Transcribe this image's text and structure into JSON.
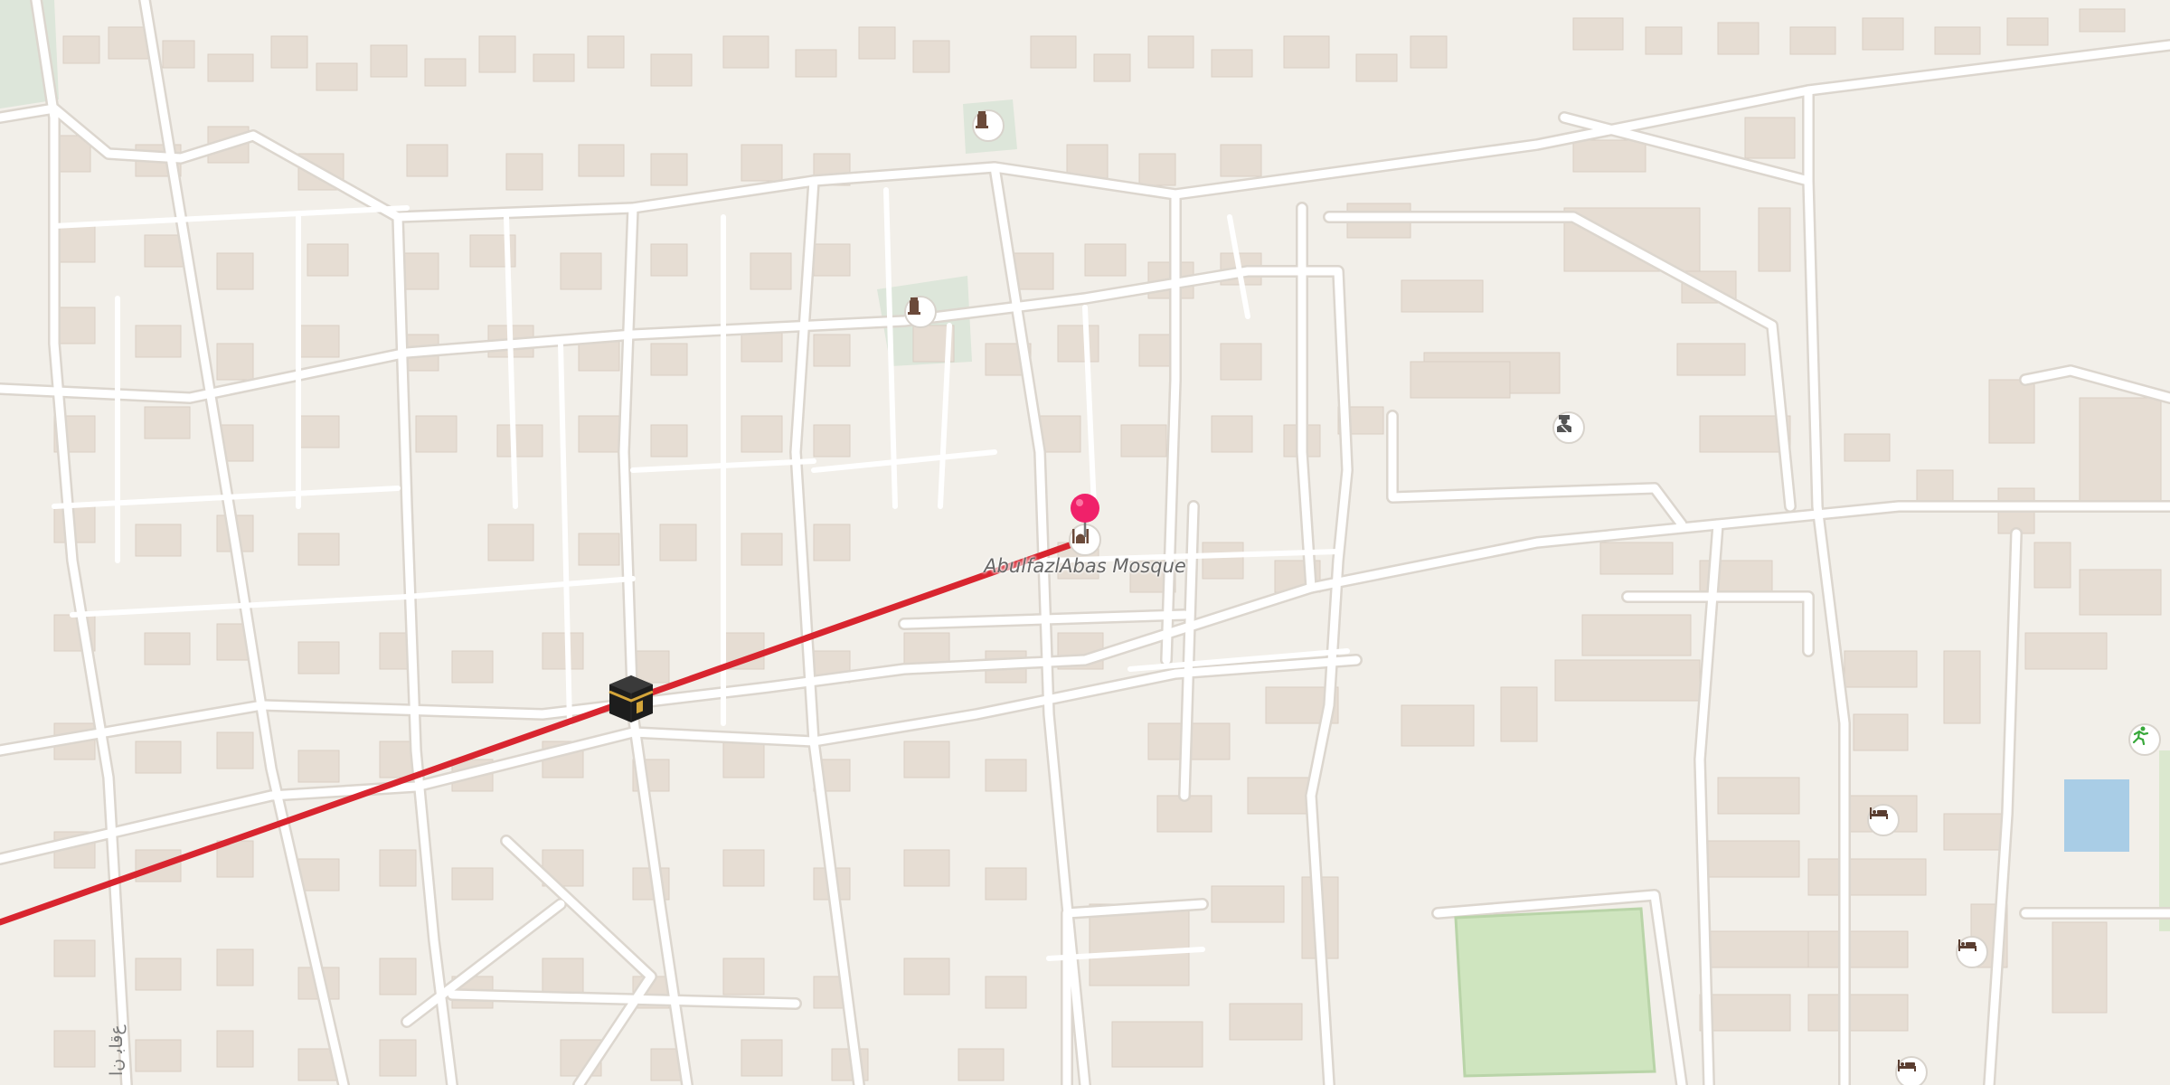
{
  "map": {
    "place_label": "AbulfazlAbas Mosque",
    "street_label": "ﻉﻗﺎﺑ ﻥﺍ",
    "colors": {
      "land": "#f2efe9",
      "building": "#e6ddd3",
      "road": "#ffffff",
      "road_edge": "#dcd6ce",
      "park": "#cfe5bf",
      "cemetery": "#dde6da",
      "water": "#a9cde6",
      "route": "#d8252f",
      "pin": "#f0216a"
    },
    "icons": {
      "destination": "map-pin-icon",
      "origin": "kaaba-icon",
      "mosque": "mosque-icon",
      "cemetery": "cemetery-icon",
      "police": "police-icon",
      "hotel": "hotel-icon",
      "sport": "sport-icon"
    }
  }
}
